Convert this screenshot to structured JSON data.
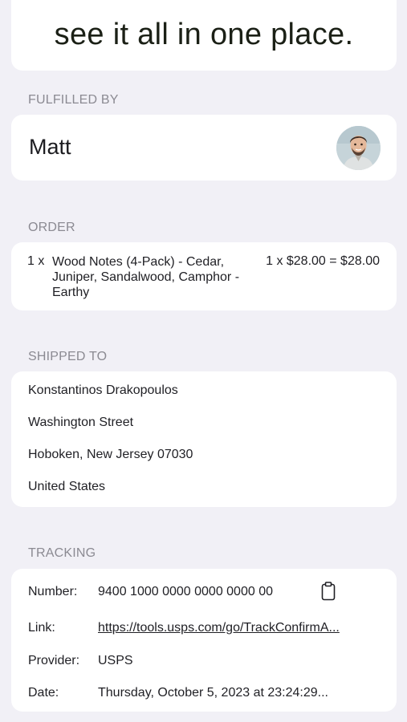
{
  "hero": {
    "text": "see it all in one place."
  },
  "fulfilled": {
    "section_label": "FULFILLED BY",
    "name": "Matt",
    "avatar_icon": "person-avatar"
  },
  "order": {
    "section_label": "ORDER",
    "items": [
      {
        "qty": "1 x",
        "description": "Wood Notes (4-Pack) - Cedar, Juniper, Sandalwood, Camphor - Earthy",
        "price": "1 x $28.00 = $28.00"
      }
    ]
  },
  "shipping": {
    "section_label": "SHIPPED TO",
    "lines": [
      "Konstantinos Drakopoulos",
      "Washington Street",
      "Hoboken, New Jersey 07030",
      "United States"
    ]
  },
  "tracking": {
    "section_label": "TRACKING",
    "number_label": "Number:",
    "number": "9400 1000 0000 0000 0000 00",
    "copy_icon": "clipboard-icon",
    "link_label": "Link:",
    "link": "https://tools.usps.com/go/TrackConfirmA...",
    "provider_label": "Provider:",
    "provider": "USPS",
    "date_label": "Date:",
    "date": "Thursday, October 5, 2023 at 23:24:29..."
  }
}
